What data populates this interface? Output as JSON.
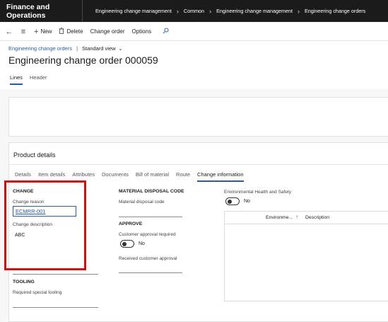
{
  "app": {
    "title": "Finance and Operations"
  },
  "breadcrumbs": [
    "Engineering change management",
    "Common",
    "Engineering change management",
    "Engineering change orders"
  ],
  "actions": {
    "new_label": "New",
    "delete_label": "Delete",
    "change_order_label": "Change order",
    "options_label": "Options"
  },
  "view": {
    "link": "Engineering change orders",
    "current": "Standard view"
  },
  "page": {
    "title": "Engineering change order 000059"
  },
  "tabs": [
    {
      "label": "Lines",
      "active": true
    },
    {
      "label": "Header",
      "active": false
    }
  ],
  "product_details": {
    "title": "Product details",
    "tabs": [
      {
        "label": "Details"
      },
      {
        "label": "Item details"
      },
      {
        "label": "Attributes"
      },
      {
        "label": "Documents"
      },
      {
        "label": "Bill of material"
      },
      {
        "label": "Route"
      },
      {
        "label": "Change information",
        "active": true
      }
    ],
    "change": {
      "group": "CHANGE",
      "reason_label": "Change reason",
      "reason_value": "ECMRR-001",
      "description_label": "Change description",
      "description_value": "ABC"
    },
    "tooling": {
      "group": "TOOLING",
      "required_label": "Required special tooling"
    },
    "material": {
      "group": "MATERIAL DISPOSAL CODE",
      "code_label": "Material disposal code"
    },
    "approve": {
      "group": "APPROVE",
      "customer_required_label": "Customer approval required",
      "customer_required_value": "No",
      "received_label": "Received customer approval"
    },
    "ehs": {
      "label": "Environmental Health and Safety",
      "value": "No",
      "columns": [
        "Environme...",
        "Description"
      ]
    }
  },
  "icons": {
    "back": "back-arrow-icon",
    "menu": "hamburger-icon",
    "new": "plus-icon",
    "delete": "trash-icon",
    "search": "search-icon",
    "sort": "sort-arrow-icon"
  },
  "colors": {
    "topbar": "#1b1b1b",
    "accent": "#2b5a9e",
    "highlight": "#d01010"
  }
}
